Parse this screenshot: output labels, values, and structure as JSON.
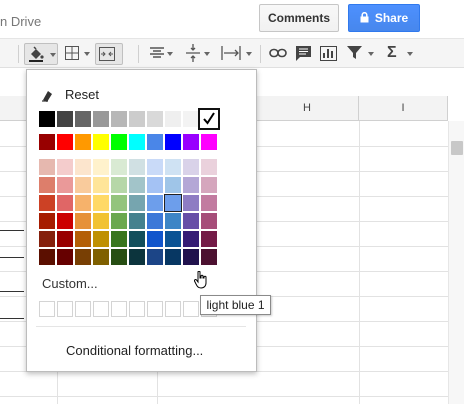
{
  "header": {
    "doc_title": "n Drive",
    "comments_label": "Comments",
    "share_label": "Share"
  },
  "toolbar": {
    "items": [
      "fill-color",
      "borders",
      "merge-cells",
      "horizontal-align",
      "vertical-align",
      "text-wrap",
      "insert-link",
      "insert-comment",
      "insert-chart",
      "filter",
      "functions"
    ]
  },
  "sheet": {
    "column_headers": [
      "H",
      "I"
    ]
  },
  "fill_menu": {
    "reset_label": "Reset",
    "selected_color": "#ffffff",
    "grayscale_row": [
      "#000000",
      "#434343",
      "#666666",
      "#999999",
      "#b7b7b7",
      "#cccccc",
      "#d9d9d9",
      "#efefef",
      "#f3f3f3",
      "#ffffff"
    ],
    "bright_row": [
      "#980000",
      "#ff0000",
      "#ff9900",
      "#ffff00",
      "#00ff00",
      "#00ffff",
      "#4a86e8",
      "#0000ff",
      "#9900ff",
      "#ff00ff"
    ],
    "shade_rows": [
      [
        "#e6b8af",
        "#f4cccc",
        "#fce5cd",
        "#fff2cc",
        "#d9ead3",
        "#d0e0e3",
        "#c9daf8",
        "#cfe2f3",
        "#d9d2e9",
        "#ead1dc"
      ],
      [
        "#dd7e6b",
        "#ea9999",
        "#f9cb9c",
        "#ffe599",
        "#b6d7a8",
        "#a2c4c9",
        "#a4c2f4",
        "#9fc5e8",
        "#b4a7d6",
        "#d5a6bd"
      ],
      [
        "#cc4125",
        "#e06666",
        "#f6b26b",
        "#ffd966",
        "#93c47d",
        "#76a5af",
        "#6d9eeb",
        "#6fa8dc",
        "#8e7cc3",
        "#c27ba0"
      ],
      [
        "#a61c00",
        "#cc0000",
        "#e69138",
        "#f1c232",
        "#6aa84f",
        "#45818e",
        "#3c78d8",
        "#3d85c6",
        "#674ea7",
        "#a64d79"
      ],
      [
        "#85200c",
        "#990000",
        "#b45f06",
        "#bf9000",
        "#38761d",
        "#134f5c",
        "#1155cc",
        "#0b5394",
        "#351c75",
        "#741b47"
      ],
      [
        "#5b0f00",
        "#660000",
        "#783f04",
        "#7f6000",
        "#274e13",
        "#0c343d",
        "#1c4587",
        "#073763",
        "#20124d",
        "#4c1130"
      ]
    ],
    "custom_label": "Custom...",
    "custom_slots": 10,
    "conditional_label": "Conditional formatting...",
    "tooltip_text": "light blue 1"
  }
}
